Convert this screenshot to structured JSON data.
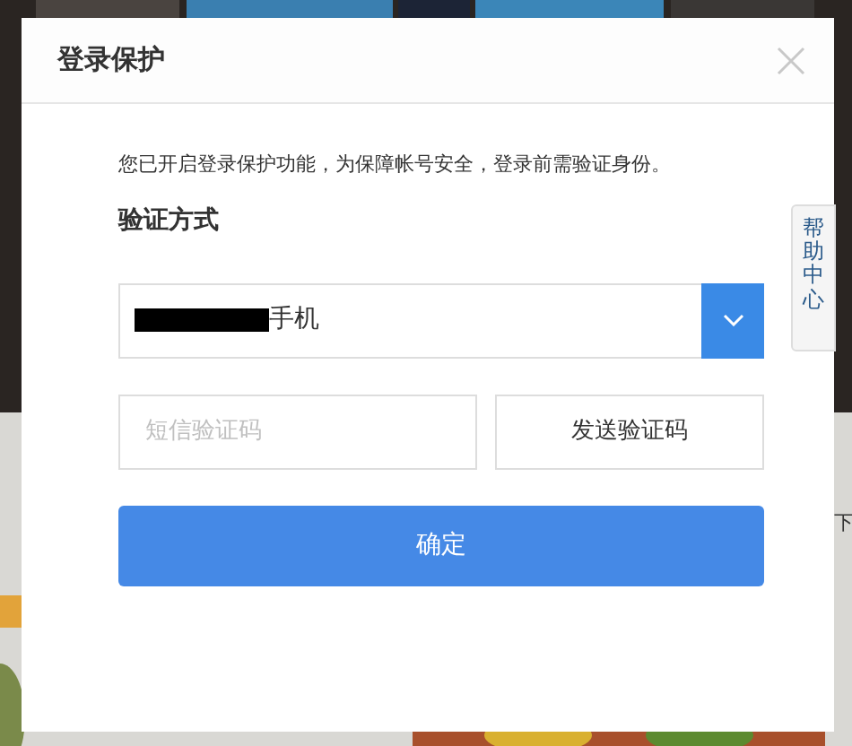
{
  "background": {
    "side_text": "下"
  },
  "dialog": {
    "title": "登录保护",
    "notice": "您已开启登录保护功能，为保障帐号安全，登录前需验证身份。",
    "section_label": "验证方式",
    "method_select": {
      "value": "手机",
      "redacted": true
    },
    "code_field": {
      "placeholder": "短信验证码"
    },
    "send_button": "发送验证码",
    "confirm_button": "确定"
  },
  "help_tab": {
    "label": "帮助中心"
  }
}
